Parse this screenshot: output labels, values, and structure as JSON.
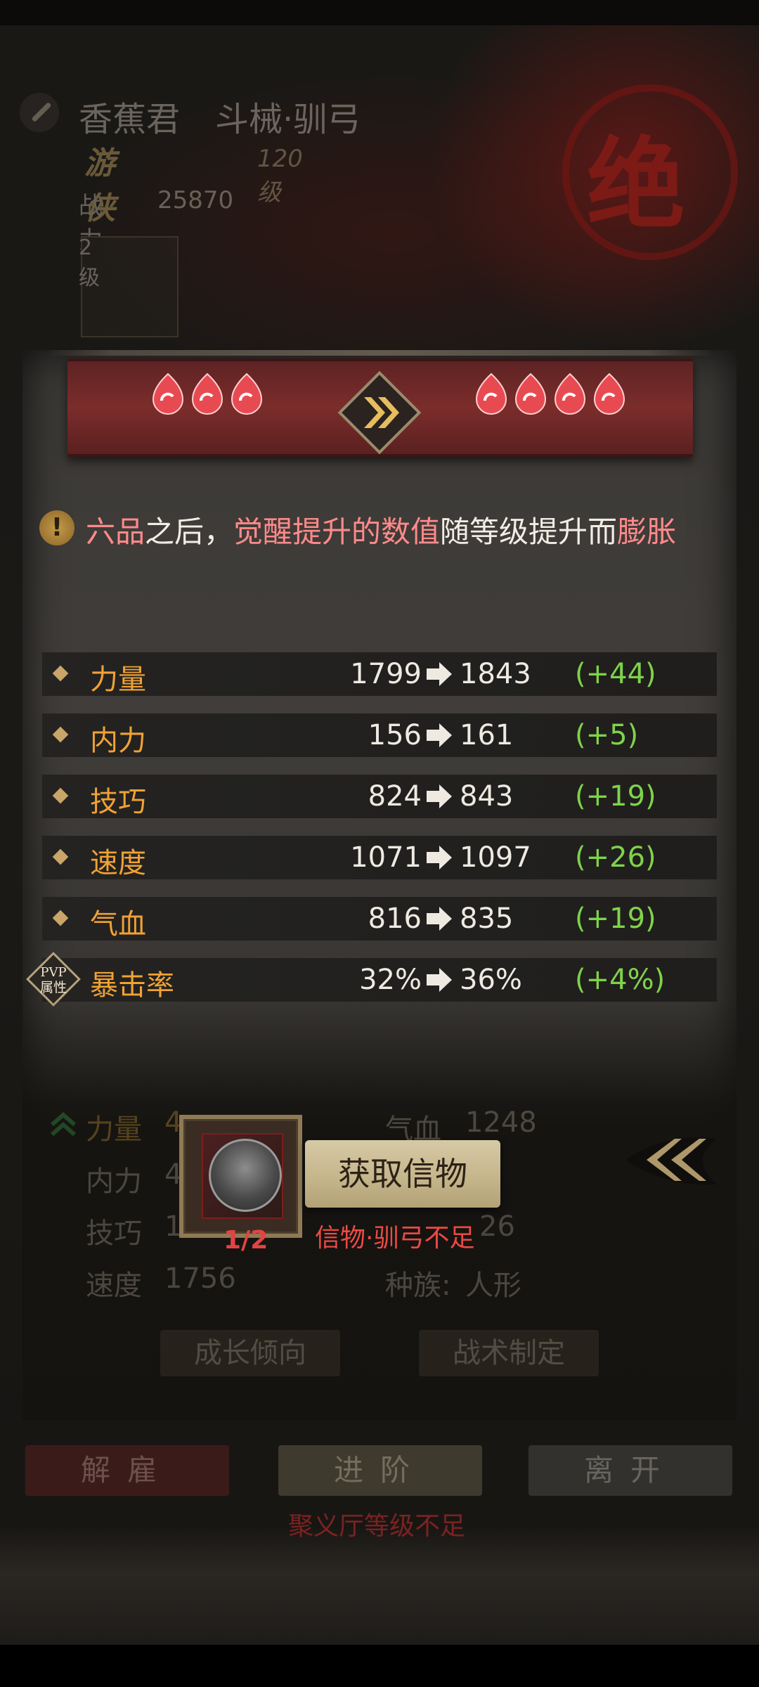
{
  "hero": {
    "name": "香蕉君",
    "job": "斗械·驯弓",
    "rank": "游侠一品",
    "level": "120级",
    "power_label": "战力",
    "power_value": "25870",
    "weapon_level": "2级",
    "seal_char": "绝"
  },
  "notice": {
    "part1": "六品",
    "part2": "之后，",
    "part3": "觉醒提升的数值",
    "part4": "随等级提升而",
    "part5": "膨胀"
  },
  "stats": [
    {
      "name": "力量",
      "old": "1799",
      "new": "1843",
      "delta": "(+44)"
    },
    {
      "name": "内力",
      "old": "156",
      "new": "161",
      "delta": "(+5)"
    },
    {
      "name": "技巧",
      "old": "824",
      "new": "843",
      "delta": "(+19)"
    },
    {
      "name": "速度",
      "old": "1071",
      "new": "1097",
      "delta": "(+26)"
    },
    {
      "name": "气血",
      "old": "816",
      "new": "835",
      "delta": "(+19)"
    },
    {
      "name": "暴击率",
      "old": "32%",
      "new": "36%",
      "delta": "(+4%)"
    }
  ],
  "pvp_badge": {
    "line1": "PVP",
    "line2": "属性"
  },
  "awakening": {
    "from_gems": 3,
    "to_gems": 4
  },
  "bg_stats": {
    "strength_label": "力量",
    "strength_value": "4",
    "hp_label": "气血",
    "hp_value": "1248",
    "inner_label": "内力",
    "inner_value": "4",
    "skill_label": "技巧",
    "skill_value": "1",
    "def_value": "26",
    "speed_label": "速度",
    "speed_value": "1756",
    "race_label": "种族:",
    "race_value": "人形",
    "growth_button": "成长倾向",
    "tactics_button": "战术制定"
  },
  "token_popup": {
    "count": "1/2",
    "obtain_button": "获取信物",
    "warning": "信物·驯弓不足"
  },
  "bottom": {
    "dismiss_button": "解雇",
    "advance_button": "进阶",
    "leave_button": "离开",
    "warning": "聚义厅等级不足"
  },
  "colors": {
    "stat_name": "#f0a235",
    "delta": "#7fd34a",
    "highlight": "#ff8a8a",
    "warning": "#ec4a45",
    "gem": "#e84a52"
  }
}
